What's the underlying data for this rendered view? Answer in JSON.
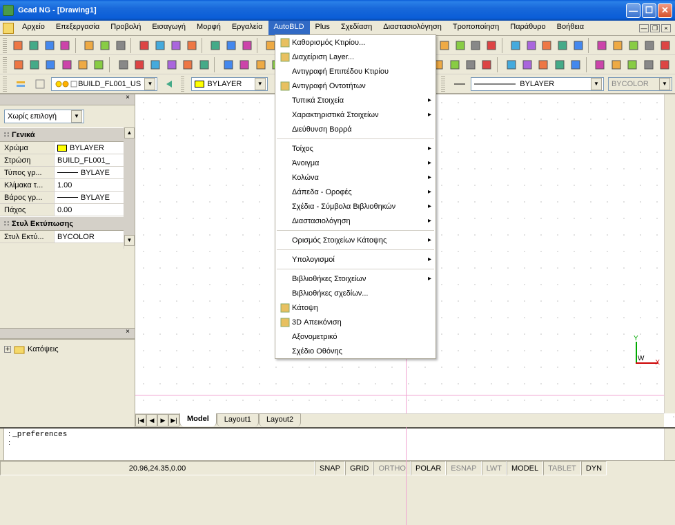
{
  "window": {
    "title": "Gcad NG  - [Drawing1]"
  },
  "menu": [
    "Αρχείο",
    "Επεξεργασία",
    "Προβολή",
    "Εισαγωγή",
    "Μορφή",
    "Εργαλεία",
    "AutoBLD",
    "Plus",
    "Σχεδίαση",
    "Διαστασιολόγηση",
    "Τροποποίηση",
    "Παράθυρο",
    "Βοήθεια"
  ],
  "active_menu_index": 6,
  "layer_bar": {
    "layer_combo": "BUILD_FL001_US",
    "color_combo": "BYLAYER",
    "linetype_combo": "BYLAYER",
    "color2_combo": "BYCOLOR"
  },
  "properties_panel": {
    "selection": "Χωρίς επιλογή",
    "sections": [
      {
        "title": "Γενικά",
        "rows": [
          {
            "k": "Χρώμα",
            "v": "BYLAYER",
            "swatch": "yellow"
          },
          {
            "k": "Στρώση",
            "v": "BUILD_FL001_"
          },
          {
            "k": "Τύπος γρ...",
            "v": "BYLAYE",
            "line": true
          },
          {
            "k": "Κλίμακα τ...",
            "v": "1.00"
          },
          {
            "k": "Βάρος γρ...",
            "v": "BYLAYE",
            "line": true
          },
          {
            "k": "Πάχος",
            "v": "0.00"
          }
        ]
      },
      {
        "title": "Στυλ Εκτύπωσης",
        "rows": [
          {
            "k": "Στυλ Εκτύ...",
            "v": "BYCOLOR"
          }
        ]
      }
    ]
  },
  "tree": {
    "plus": "+",
    "label": "Κατόψεις"
  },
  "tabs": {
    "nav": [
      "|◀",
      "◀",
      "▶",
      "▶|"
    ],
    "items": [
      "Model",
      "Layout1",
      "Layout2"
    ],
    "active_index": 0
  },
  "command": {
    "line1": "_preferences",
    "prompt": ":"
  },
  "status": {
    "coords": "20.96,24.35,0.00",
    "cells": [
      {
        "t": "SNAP",
        "on": true
      },
      {
        "t": "GRID",
        "on": true
      },
      {
        "t": "ORTHO",
        "on": false
      },
      {
        "t": "POLAR",
        "on": true
      },
      {
        "t": "ESNAP",
        "on": false
      },
      {
        "t": "LWT",
        "on": false
      },
      {
        "t": "MODEL",
        "on": true
      },
      {
        "t": "TABLET",
        "on": false
      },
      {
        "t": "DYN",
        "on": true
      }
    ]
  },
  "dropdown": {
    "groups": [
      [
        {
          "t": "Καθορισμός Κτιρίου...",
          "icon": "building-icon"
        },
        {
          "t": "Διαχείριση Layer...",
          "icon": "layers-icon"
        },
        {
          "t": "Αντιγραφή Επιπέδου Κτιρίου"
        },
        {
          "t": "Αντιγραφή Οντοτήτων",
          "icon": "copy-entity-icon"
        },
        {
          "t": "Τυπικά Στοιχεία",
          "sub": true
        },
        {
          "t": "Χαρακτηριστικά Στοιχείων",
          "sub": true
        },
        {
          "t": "Διεύθυνση Βορρά"
        }
      ],
      [
        {
          "t": "Τοίχος",
          "sub": true
        },
        {
          "t": "Άνοιγμα",
          "sub": true
        },
        {
          "t": "Κολώνα",
          "sub": true
        },
        {
          "t": "Δάπεδα - Οροφές",
          "sub": true
        },
        {
          "t": "Σχέδια - Σύμβολα Βιβλιοθηκών",
          "sub": true
        },
        {
          "t": "Διαστασιολόγηση",
          "sub": true
        }
      ],
      [
        {
          "t": "Ορισμός Στοιχείων Κάτοψης",
          "sub": true
        }
      ],
      [
        {
          "t": "Υπολογισμοί",
          "sub": true
        }
      ],
      [
        {
          "t": "Βιβλιοθήκες Στοιχείων",
          "sub": true
        },
        {
          "t": "Βιβλιοθήκες σχεδίων..."
        },
        {
          "t": "Κάτοψη",
          "icon": "plan-icon"
        },
        {
          "t": "3D Απεικόνιση",
          "icon": "3d-icon"
        },
        {
          "t": "Αξονομετρικό"
        },
        {
          "t": "Σχέδιο Οθόνης"
        }
      ]
    ]
  },
  "ucs": {
    "x": "X",
    "y": "Y",
    "w": "W"
  }
}
